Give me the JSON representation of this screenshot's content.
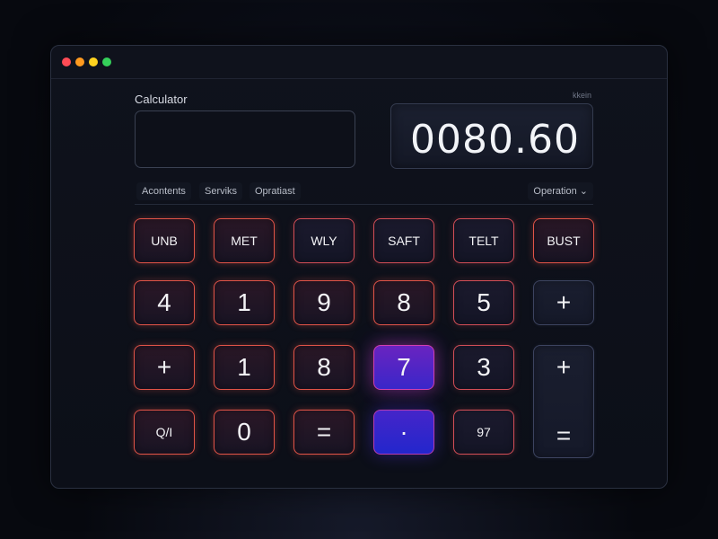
{
  "window": {
    "controls": [
      "close",
      "minimize",
      "maximize",
      "fullscreen"
    ]
  },
  "header": {
    "title": "Calculator",
    "tiny_label": "kkein"
  },
  "input": {
    "value": ""
  },
  "display": {
    "value": "0080.60"
  },
  "tabs": [
    {
      "label": "Acontents"
    },
    {
      "label": "Serviks"
    },
    {
      "label": "Opratiast"
    }
  ],
  "dropdown": {
    "label": "Operation",
    "icon": "chevron-down-icon"
  },
  "keys": {
    "row1": [
      "UNB",
      "MET",
      "WLY",
      "SAFT",
      "TELT",
      "BUST"
    ],
    "row2": [
      "4",
      "1",
      "9",
      "8",
      "5",
      "+"
    ],
    "row3": [
      "+",
      "1",
      "8",
      "7",
      "3",
      "+"
    ],
    "row4": [
      "Q/I",
      "0",
      "=",
      "·",
      "97"
    ],
    "tall": "="
  },
  "colors": {
    "accent_red": "#e25448",
    "accent_purple": "#6a24c0",
    "accent_blue": "#2326cc",
    "background": "#07090f"
  }
}
